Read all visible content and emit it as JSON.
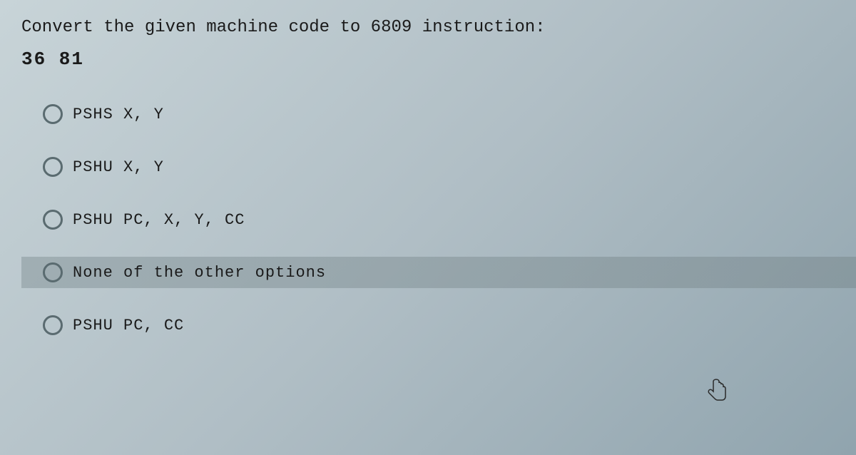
{
  "question": {
    "prompt": "Convert the given machine code to 6809 instruction:",
    "code": "36 81"
  },
  "options": [
    {
      "label": "PSHS X, Y",
      "hovered": false
    },
    {
      "label": "PSHU X, Y",
      "hovered": false
    },
    {
      "label": "PSHU PC, X, Y, CC",
      "hovered": false
    },
    {
      "label": "None of the other options",
      "hovered": true
    },
    {
      "label": "PSHU PC, CC",
      "hovered": false
    }
  ]
}
